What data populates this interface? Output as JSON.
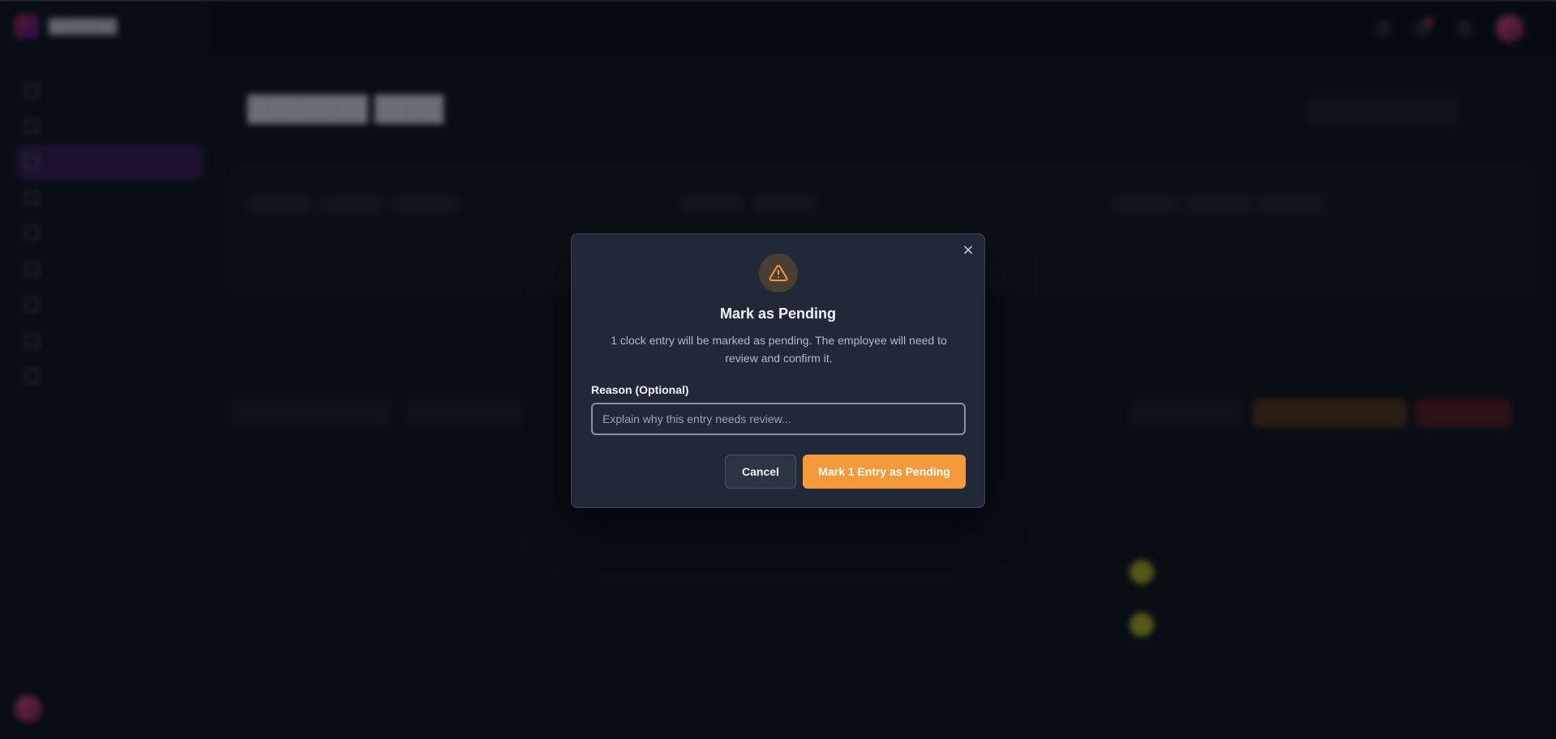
{
  "modal": {
    "title": "Mark as Pending",
    "description": "1 clock entry will be marked as pending. The employee will need to review and confirm it.",
    "field_label": "Reason (Optional)",
    "reason_placeholder": "Explain why this entry needs review...",
    "reason_value": "",
    "cancel_label": "Cancel",
    "confirm_label": "Mark 1 Entry as Pending",
    "close_icon": "close-icon",
    "warning_icon": "warning-triangle-icon"
  },
  "colors": {
    "accent": "#f59a3c",
    "modal_bg": "#1f2937",
    "warning_icon": "#f59a3c"
  }
}
